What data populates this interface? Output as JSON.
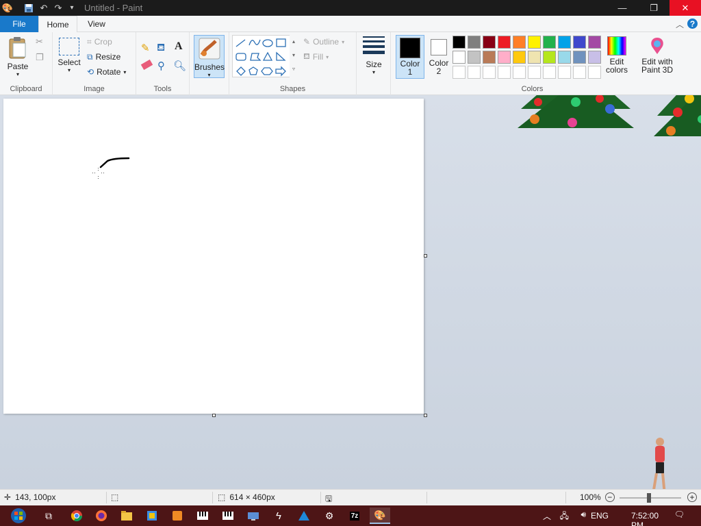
{
  "titlebar": {
    "title": "Untitled - Paint",
    "qat_customize": "▾"
  },
  "tabs": {
    "file": "File",
    "home": "Home",
    "view": "View"
  },
  "clipboard": {
    "paste": "Paste",
    "label": "Clipboard"
  },
  "image": {
    "select": "Select",
    "crop": "Crop",
    "resize": "Resize",
    "rotate": "Rotate",
    "label": "Image"
  },
  "tools": {
    "label": "Tools",
    "text_glyph": "A"
  },
  "brushes": {
    "label": "Brushes"
  },
  "shapes": {
    "outline": "Outline",
    "fill": "Fill",
    "label": "Shapes"
  },
  "size": {
    "label": "Size"
  },
  "colors": {
    "color1_line1": "Color",
    "color1_line2": "1",
    "color2_line1": "Color",
    "color2_line2": "2",
    "edit_line1": "Edit",
    "edit_line2": "colors",
    "paint3d_line1": "Edit with",
    "paint3d_line2": "Paint 3D",
    "label": "Colors",
    "color1_value": "#000000",
    "color2_value": "#ffffff",
    "palette_row1": [
      "#000000",
      "#7f7f7f",
      "#880015",
      "#ed1c24",
      "#ff7f27",
      "#fff200",
      "#22b14c",
      "#00a2e8",
      "#3f48cc",
      "#a349a4"
    ],
    "palette_row2": [
      "#ffffff",
      "#c3c3c3",
      "#b97a57",
      "#ffaec9",
      "#ffc90e",
      "#efe4b0",
      "#b5e61d",
      "#99d9ea",
      "#7092be",
      "#c8bfe7"
    ]
  },
  "status": {
    "cursor_pos": "143, 100px",
    "canvas_size": "614 × 460px",
    "zoom": "100%"
  },
  "tray": {
    "lang": "ENG",
    "time": "7:52:00 PM"
  }
}
